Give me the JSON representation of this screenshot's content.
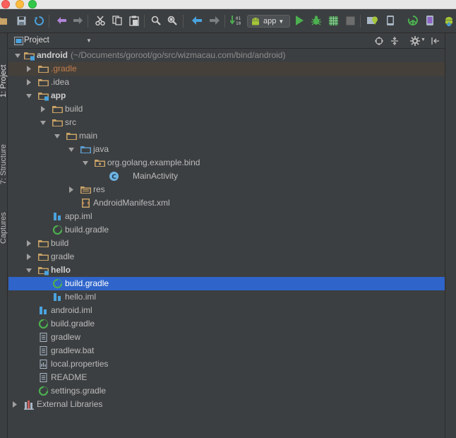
{
  "toolbar": {
    "run_config_label": "app",
    "colors": {
      "run": "#4cb050",
      "android": "#a4c639",
      "back": "#b085d8",
      "nav": "#4aa3df"
    }
  },
  "sidebar_tabs": {
    "project": "1: Project",
    "structure": "7: Structure",
    "captures": "Captures"
  },
  "panel": {
    "title": "Project"
  },
  "tree": {
    "root_label": "android",
    "root_path": "(~/Documents/goroot/go/src/wizmacau.com/bind/android)",
    "items": {
      "gradle_dir": ".gradle",
      "idea_dir": ".idea",
      "app": "app",
      "app_build": "build",
      "src": "src",
      "main": "main",
      "java": "java",
      "package": "org.golang.example.bind",
      "main_activity": "MainActivity",
      "res": "res",
      "manifest": "AndroidManifest.xml",
      "app_iml": "app.iml",
      "app_build_gradle": "build.gradle",
      "build": "build",
      "gradle": "gradle",
      "hello": "hello",
      "hello_build_gradle": "build.gradle",
      "hello_iml": "hello.iml",
      "android_iml": "android.iml",
      "root_build_gradle": "build.gradle",
      "gradlew": "gradlew",
      "gradlew_bat": "gradlew.bat",
      "local_properties": "local.properties",
      "readme": "README",
      "settings_gradle": "settings.gradle",
      "external_libraries": "External Libraries"
    },
    "selected_item": "hello/build.gradle"
  },
  "icons": {
    "folder": "folder-icon",
    "module": "module-folder-icon",
    "source": "source-folder-icon",
    "gradle": "gradle-file-icon",
    "iml": "iml-file-icon",
    "file": "text-file-icon",
    "class": "java-class-icon",
    "manifest": "manifest-file-icon",
    "libraries": "libraries-icon"
  },
  "colors": {
    "background": "#3c3f41",
    "selection": "#2f65ca",
    "highlight_row": "#46403a",
    "folder": "#c8a266",
    "source_folder": "#5d9fd3",
    "gradle": "#4cb050",
    "modified_text": "#c27e4c"
  }
}
